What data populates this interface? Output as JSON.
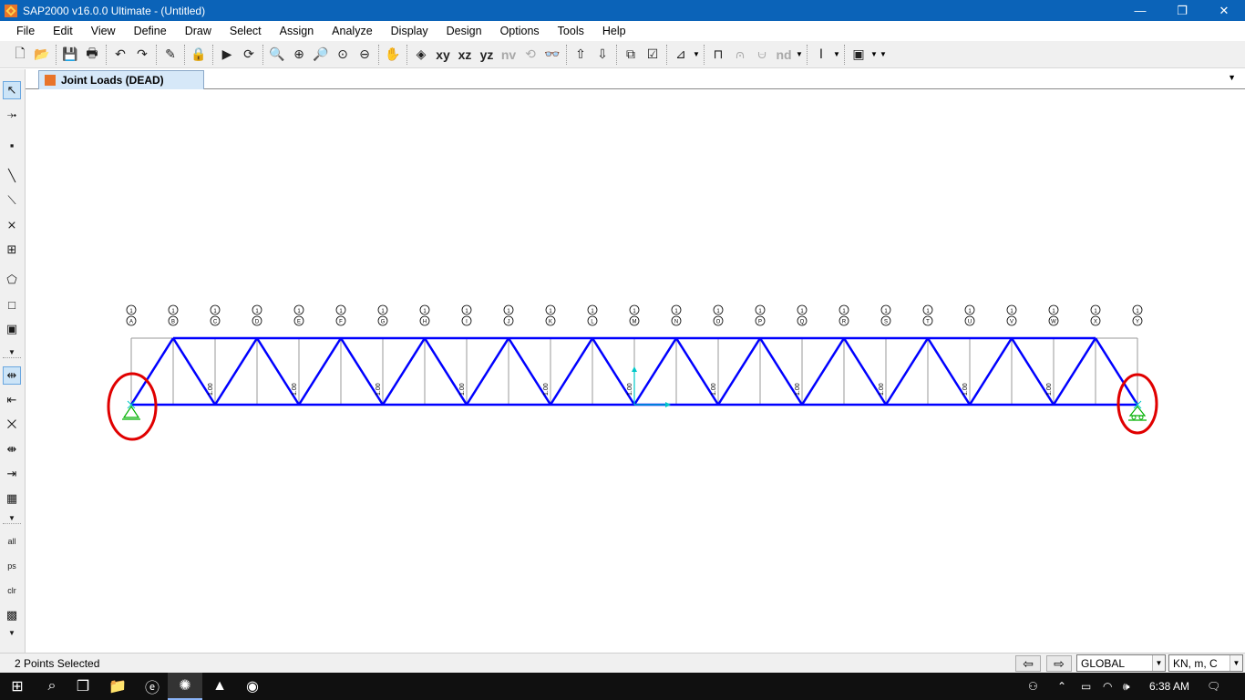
{
  "window": {
    "title": "SAP2000 v16.0.0 Ultimate  -  (Untitled)",
    "minimize_glyph": "—",
    "maximize_glyph": "❐",
    "close_glyph": "✕"
  },
  "menu": [
    "File",
    "Edit",
    "View",
    "Define",
    "Draw",
    "Select",
    "Assign",
    "Analyze",
    "Display",
    "Design",
    "Options",
    "Tools",
    "Help"
  ],
  "toolbar": {
    "view_xy": "xy",
    "view_xz": "xz",
    "view_yz": "yz",
    "view_nv": "nv",
    "nd_label": "nd"
  },
  "tab": {
    "label": "Joint Loads (DEAD)"
  },
  "model": {
    "top_chord_load_labels": [
      "A",
      "B",
      "C",
      "D",
      "E",
      "F",
      "G",
      "H",
      "I",
      "J",
      "K",
      "L",
      "M",
      "N",
      "O",
      "P",
      "Q",
      "R",
      "S",
      "T",
      "U",
      "V",
      "W",
      "X",
      "Y"
    ],
    "load_value_label": "1.00",
    "selected_supports": "2"
  },
  "status": {
    "text": "2 Points Selected",
    "coord_system": "GLOBAL",
    "units": "KN, m, C"
  },
  "taskbar": {
    "time": "6:38 AM"
  },
  "colors": {
    "titlebar": "#0b63b8",
    "frame": "#0000ff",
    "selection_circle": "#e00000",
    "support": "#00b000",
    "axis": "#00c8c8"
  }
}
